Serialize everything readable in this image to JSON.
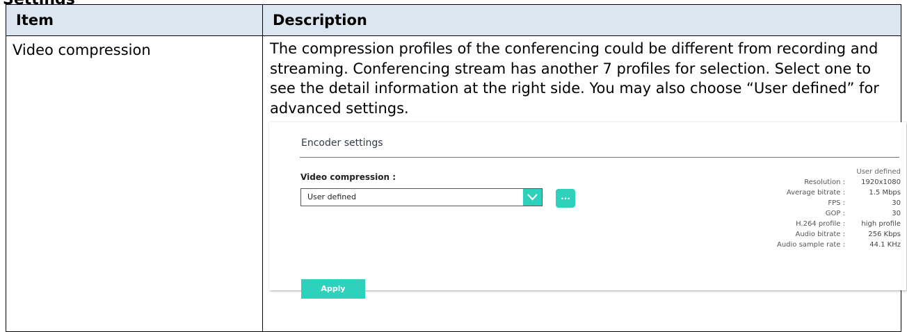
{
  "section_heading": "Settings",
  "table": {
    "headers": [
      "Item",
      "Description"
    ],
    "rows": [
      {
        "item": "Video compression",
        "description": "The compression profiles of the conferencing could be different from recording and streaming. Conferencing stream has another 7 profiles for selection. Select one to see the detail information at the right side. You may also choose “User defined” for advanced settings."
      }
    ]
  },
  "screenshot": {
    "title": "Encoder settings",
    "video_compression_label": "Video compression :",
    "selected_profile": "User defined",
    "more_button_label": "...",
    "apply_label": "Apply",
    "accent_color": "#2ed1bc",
    "info": {
      "profile_name": "User defined",
      "rows": [
        {
          "label": "Resolution :",
          "value": "1920x1080"
        },
        {
          "label": "Average bitrate :",
          "value": "1.5 Mbps"
        },
        {
          "label": "FPS :",
          "value": "30"
        },
        {
          "label": "GOP :",
          "value": "30"
        },
        {
          "label": "H.264 profile :",
          "value": "high profile"
        },
        {
          "label": "Audio bitrate :",
          "value": "256 Kbps"
        },
        {
          "label": "Audio sample rate :",
          "value": "44.1 KHz"
        }
      ]
    }
  }
}
